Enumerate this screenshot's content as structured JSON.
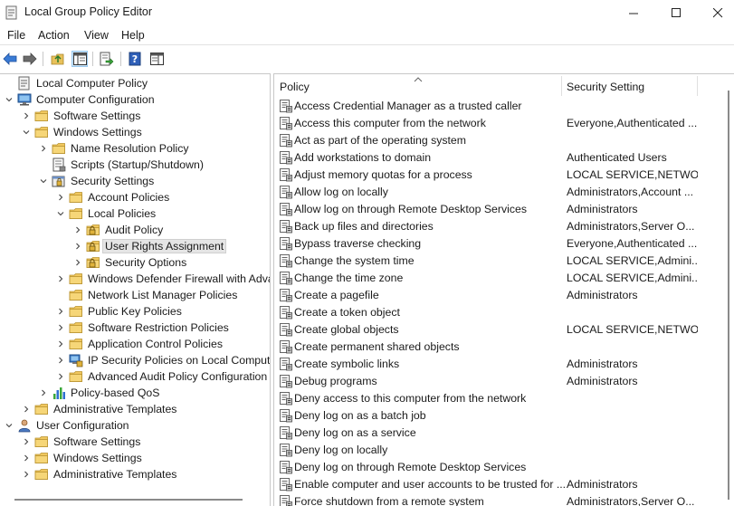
{
  "window": {
    "title": "Local Group Policy Editor"
  },
  "menu": [
    {
      "label": "File"
    },
    {
      "label": "Action"
    },
    {
      "label": "View"
    },
    {
      "label": "Help"
    }
  ],
  "toolbar": [
    {
      "name": "back-icon"
    },
    {
      "name": "forward-icon"
    },
    {
      "name": "up-folder-icon"
    },
    {
      "name": "show-hide-tree-icon",
      "pressed": true
    },
    {
      "name": "export-list-icon"
    },
    {
      "name": "help-icon"
    },
    {
      "name": "properties-pane-icon"
    }
  ],
  "tree": [
    {
      "label": "Local Computer Policy",
      "level": 0,
      "expander": "none",
      "icon": "computer-policy"
    },
    {
      "label": "Computer Configuration",
      "level": 0,
      "expander": "open",
      "icon": "computer"
    },
    {
      "label": "Software Settings",
      "level": 1,
      "expander": "closed",
      "icon": "folder"
    },
    {
      "label": "Windows Settings",
      "level": 1,
      "expander": "open",
      "icon": "folder"
    },
    {
      "label": "Name Resolution Policy",
      "level": 2,
      "expander": "closed",
      "icon": "folder"
    },
    {
      "label": "Scripts (Startup/Shutdown)",
      "level": 2,
      "expander": "none",
      "icon": "scripts"
    },
    {
      "label": "Security Settings",
      "level": 2,
      "expander": "open",
      "icon": "security"
    },
    {
      "label": "Account Policies",
      "level": 3,
      "expander": "closed",
      "icon": "folder"
    },
    {
      "label": "Local Policies",
      "level": 3,
      "expander": "open",
      "icon": "folder"
    },
    {
      "label": "Audit Policy",
      "level": 4,
      "expander": "closed",
      "icon": "lock-folder"
    },
    {
      "label": "User Rights Assignment",
      "level": 4,
      "expander": "closed",
      "icon": "lock-folder",
      "selected": true
    },
    {
      "label": "Security Options",
      "level": 4,
      "expander": "closed",
      "icon": "lock-folder"
    },
    {
      "label": "Windows Defender Firewall with Adva",
      "level": 3,
      "expander": "closed",
      "icon": "folder"
    },
    {
      "label": "Network List Manager Policies",
      "level": 3,
      "expander": "none",
      "icon": "folder"
    },
    {
      "label": "Public Key Policies",
      "level": 3,
      "expander": "closed",
      "icon": "folder"
    },
    {
      "label": "Software Restriction Policies",
      "level": 3,
      "expander": "closed",
      "icon": "folder"
    },
    {
      "label": "Application Control Policies",
      "level": 3,
      "expander": "closed",
      "icon": "folder"
    },
    {
      "label": "IP Security Policies on Local Compute",
      "level": 3,
      "expander": "closed",
      "icon": "ipsec"
    },
    {
      "label": "Advanced Audit Policy Configuration",
      "level": 3,
      "expander": "closed",
      "icon": "folder"
    },
    {
      "label": "Policy-based QoS",
      "level": 2,
      "expander": "closed",
      "icon": "chart"
    },
    {
      "label": "Administrative Templates",
      "level": 1,
      "expander": "closed",
      "icon": "folder"
    },
    {
      "label": "User Configuration",
      "level": 0,
      "expander": "open",
      "icon": "user"
    },
    {
      "label": "Software Settings",
      "level": 1,
      "expander": "closed",
      "icon": "folder"
    },
    {
      "label": "Windows Settings",
      "level": 1,
      "expander": "closed",
      "icon": "folder"
    },
    {
      "label": "Administrative Templates",
      "level": 1,
      "expander": "closed",
      "icon": "folder"
    }
  ],
  "list": {
    "columns": [
      {
        "label": "Policy"
      },
      {
        "label": "Security Setting"
      }
    ],
    "rows": [
      {
        "policy": "Access Credential Manager as a trusted caller",
        "setting": ""
      },
      {
        "policy": "Access this computer from the network",
        "setting": "Everyone,Authenticated ..."
      },
      {
        "policy": "Act as part of the operating system",
        "setting": ""
      },
      {
        "policy": "Add workstations to domain",
        "setting": "Authenticated Users"
      },
      {
        "policy": "Adjust memory quotas for a process",
        "setting": "LOCAL SERVICE,NETWO..."
      },
      {
        "policy": "Allow log on locally",
        "setting": "Administrators,Account ..."
      },
      {
        "policy": "Allow log on through Remote Desktop Services",
        "setting": "Administrators"
      },
      {
        "policy": "Back up files and directories",
        "setting": "Administrators,Server O..."
      },
      {
        "policy": "Bypass traverse checking",
        "setting": "Everyone,Authenticated ..."
      },
      {
        "policy": "Change the system time",
        "setting": "LOCAL SERVICE,Admini..."
      },
      {
        "policy": "Change the time zone",
        "setting": "LOCAL SERVICE,Admini..."
      },
      {
        "policy": "Create a pagefile",
        "setting": "Administrators"
      },
      {
        "policy": "Create a token object",
        "setting": ""
      },
      {
        "policy": "Create global objects",
        "setting": "LOCAL SERVICE,NETWO..."
      },
      {
        "policy": "Create permanent shared objects",
        "setting": ""
      },
      {
        "policy": "Create symbolic links",
        "setting": "Administrators"
      },
      {
        "policy": "Debug programs",
        "setting": "Administrators"
      },
      {
        "policy": "Deny access to this computer from the network",
        "setting": ""
      },
      {
        "policy": "Deny log on as a batch job",
        "setting": ""
      },
      {
        "policy": "Deny log on as a service",
        "setting": ""
      },
      {
        "policy": "Deny log on locally",
        "setting": ""
      },
      {
        "policy": "Deny log on through Remote Desktop Services",
        "setting": ""
      },
      {
        "policy": "Enable computer and user accounts to be trusted for ...",
        "setting": "Administrators"
      },
      {
        "policy": "Force shutdown from a remote system",
        "setting": "Administrators,Server O..."
      }
    ]
  }
}
